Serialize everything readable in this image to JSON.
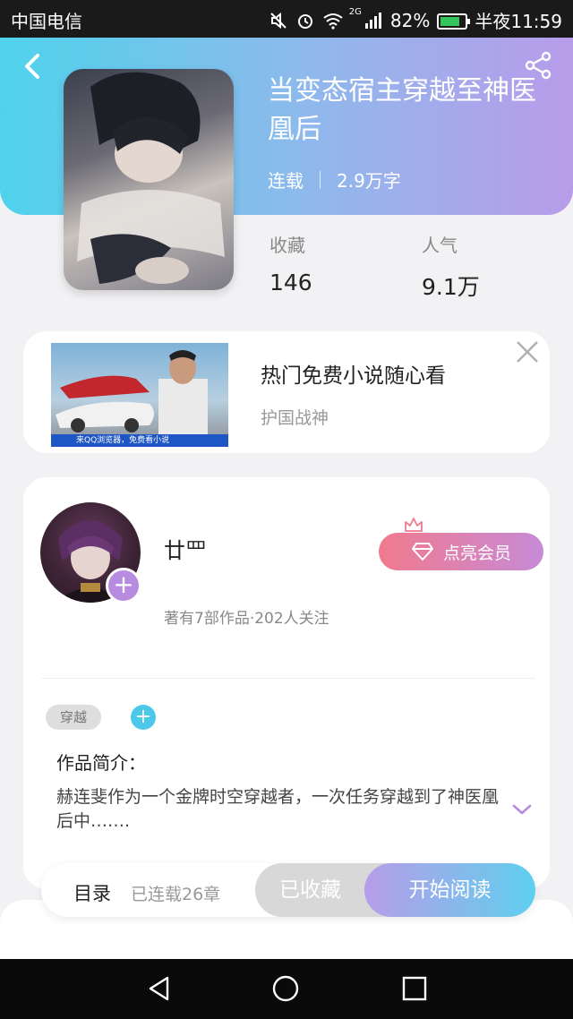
{
  "status_bar": {
    "carrier": "中国电信",
    "network": "2G",
    "battery": "82%",
    "battery_level": 0.82,
    "time": "半夜11:59"
  },
  "book": {
    "title": "当变态宿主穿越至神医凰后",
    "status": "连载",
    "word_count": "2.9万字",
    "stats": [
      {
        "label": "收藏",
        "value": "146"
      },
      {
        "label": "人气",
        "value": "9.1万"
      }
    ]
  },
  "ad": {
    "title": "热门免费小说随心看",
    "subtitle": "护国战神",
    "image_caption": "来QQ浏览器，免费看小说"
  },
  "author": {
    "name": "廿罒",
    "works": "著有7部作品·202人关注",
    "vip_label": "点亮会员",
    "follow_symbol": "+"
  },
  "intro": {
    "tag": "穿越",
    "add_tag_symbol": "+",
    "label": "作品简介：",
    "text": "赫连斐作为一个金牌时空穿越者，一次任务穿越到了神医凰后中……."
  },
  "bottom_bar": {
    "toc_label": "目录",
    "chapters": "已连载26章",
    "collected_label": "已收藏",
    "read_label": "开始阅读"
  },
  "colors": {
    "header_start": "#4fd3ec",
    "header_end": "#b89cea",
    "vip_start": "#f07a8e",
    "vip_end": "#c88ad7",
    "accent_blue": "#4cc9ea",
    "accent_purple": "#b78be0"
  }
}
